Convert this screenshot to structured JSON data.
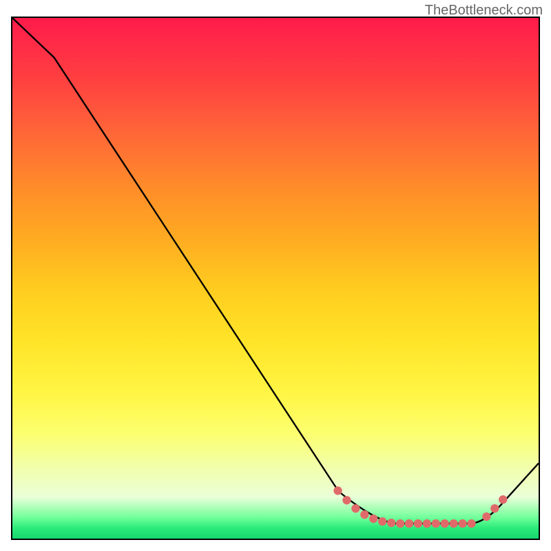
{
  "watermark": "TheBottleneck.com",
  "chart_data": {
    "type": "line",
    "title": "",
    "xlabel": "",
    "ylabel": "",
    "xlim": [
      0,
      100
    ],
    "ylim": [
      0,
      100
    ],
    "series": [
      {
        "name": "curve",
        "x": [
          0,
          8,
          62,
          72,
          88,
          100
        ],
        "y": [
          100,
          92,
          9,
          2.5,
          2.5,
          15
        ]
      }
    ],
    "scatter_points_x": [
      62,
      64,
      66,
      68,
      70,
      72,
      74,
      76,
      78,
      80,
      82,
      84,
      86,
      88,
      90,
      91.5,
      93
    ],
    "scatter_points_y": [
      9,
      7,
      5.5,
      4.3,
      3.3,
      2.8,
      2.6,
      2.5,
      2.5,
      2.5,
      2.5,
      2.5,
      2.5,
      2.6,
      4.5,
      6.2,
      8
    ],
    "gradient_stops": [
      {
        "pct": 0,
        "color": "#ff1a4a"
      },
      {
        "pct": 50,
        "color": "#ffd820"
      },
      {
        "pct": 82,
        "color": "#fbff80"
      },
      {
        "pct": 98,
        "color": "#2aeb7a"
      },
      {
        "pct": 100,
        "color": "#17d66e"
      }
    ]
  }
}
